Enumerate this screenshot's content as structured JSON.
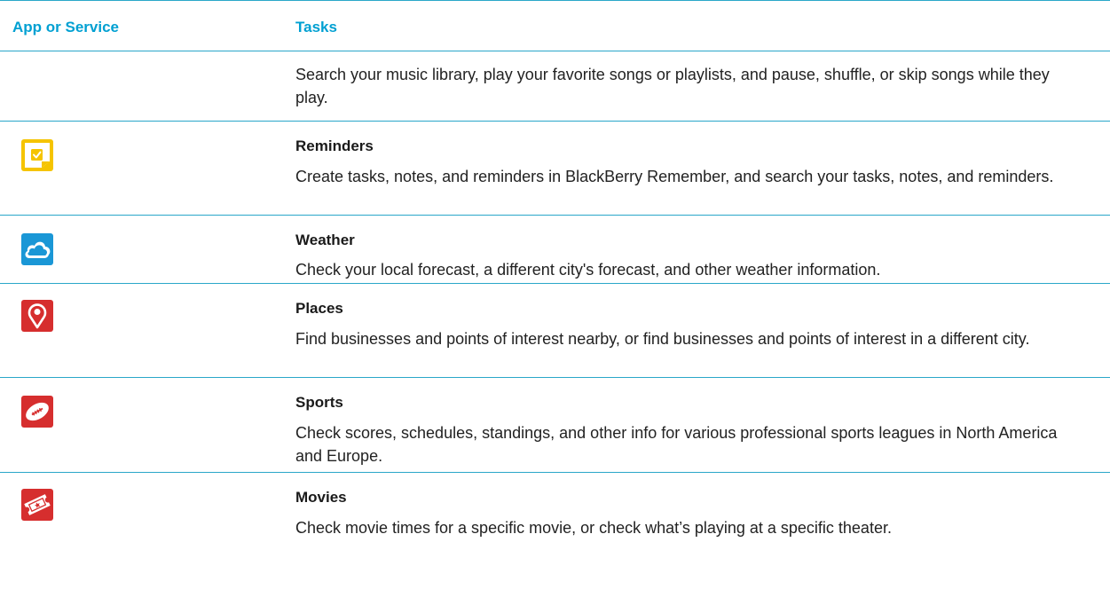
{
  "header": {
    "col_app": "App or Service",
    "col_tasks": "Tasks"
  },
  "colors": {
    "accent": "#00a0d2",
    "rule": "#2aa7c9"
  },
  "rows": [
    {
      "icon": "none",
      "title": "",
      "description": "Search your music library, play your favorite songs or playlists, and pause, shuffle, or skip songs while they play."
    },
    {
      "icon": "reminders-icon",
      "title": "Reminders",
      "description": "Create tasks, notes, and reminders in BlackBerry Remember, and search your tasks, notes, and reminders."
    },
    {
      "icon": "weather-icon",
      "title": "Weather",
      "description": "Check your local forecast, a different city's forecast, and other weather information."
    },
    {
      "icon": "places-icon",
      "title": "Places",
      "description": "Find businesses and points of interest nearby, or find businesses and points of interest in a different city."
    },
    {
      "icon": "sports-icon",
      "title": "Sports",
      "description": "Check scores, schedules, standings, and other info for various professional sports leagues in North America and Europe."
    },
    {
      "icon": "movies-icon",
      "title": "Movies",
      "description": "Check movie times for a specific movie, or check what’s playing at a specific theater."
    }
  ]
}
